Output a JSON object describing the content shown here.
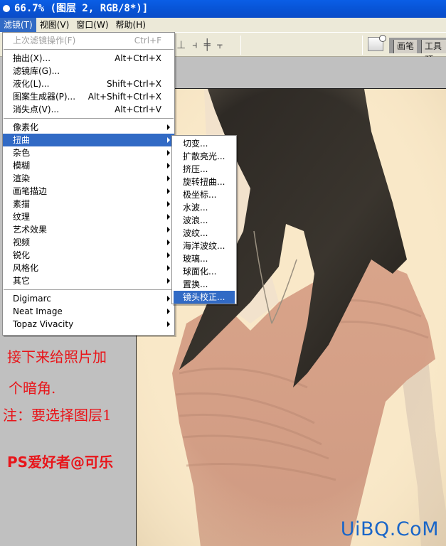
{
  "window": {
    "title": "66.7% (图层 2, RGB/8*)]"
  },
  "menubar": {
    "items": [
      {
        "label": "滤镜(T)",
        "active": true
      },
      {
        "label": "视图(V)",
        "active": false
      },
      {
        "label": "窗口(W)",
        "active": false
      },
      {
        "label": "帮助(H)",
        "active": false
      }
    ]
  },
  "optionsbar": {
    "align_icons": [
      "align-bottom-edges-icon",
      "distribute-left-icon",
      "distribute-horizontal-centers-icon",
      "distribute-right-icon"
    ],
    "palette_tabs": [
      "画笔",
      "工具预"
    ]
  },
  "filter_menu": {
    "last_filter": {
      "label": "上次滤镜操作(F)",
      "shortcut": "Ctrl+F",
      "disabled": true
    },
    "group1": [
      {
        "label": "抽出(X)...",
        "shortcut": "Alt+Ctrl+X"
      },
      {
        "label": "滤镜库(G)...",
        "shortcut": ""
      },
      {
        "label": "液化(L)...",
        "shortcut": "Shift+Ctrl+X"
      },
      {
        "label": "图案生成器(P)...",
        "shortcut": "Alt+Shift+Ctrl+X"
      },
      {
        "label": "消失点(V)...",
        "shortcut": "Alt+Ctrl+V"
      }
    ],
    "group2": [
      {
        "label": "像素化",
        "highlight": false
      },
      {
        "label": "扭曲",
        "highlight": true
      },
      {
        "label": "杂色",
        "highlight": false
      },
      {
        "label": "模糊",
        "highlight": false
      },
      {
        "label": "渲染",
        "highlight": false
      },
      {
        "label": "画笔描边",
        "highlight": false
      },
      {
        "label": "素描",
        "highlight": false
      },
      {
        "label": "纹理",
        "highlight": false
      },
      {
        "label": "艺术效果",
        "highlight": false
      },
      {
        "label": "视频",
        "highlight": false
      },
      {
        "label": "锐化",
        "highlight": false
      },
      {
        "label": "风格化",
        "highlight": false
      },
      {
        "label": "其它",
        "highlight": false
      }
    ],
    "group3": [
      {
        "label": "Digimarc"
      },
      {
        "label": "Neat Image"
      },
      {
        "label": "Topaz Vivacity"
      }
    ]
  },
  "distort_submenu": {
    "items": [
      {
        "label": "切变...",
        "highlight": false
      },
      {
        "label": "扩散亮光...",
        "highlight": false
      },
      {
        "label": "挤压...",
        "highlight": false
      },
      {
        "label": "旋转扭曲...",
        "highlight": false
      },
      {
        "label": "极坐标...",
        "highlight": false
      },
      {
        "label": "水波...",
        "highlight": false
      },
      {
        "label": "波浪...",
        "highlight": false
      },
      {
        "label": "波纹...",
        "highlight": false
      },
      {
        "label": "海洋波纹...",
        "highlight": false
      },
      {
        "label": "玻璃...",
        "highlight": false
      },
      {
        "label": "球面化...",
        "highlight": false
      },
      {
        "label": "置换...",
        "highlight": false
      },
      {
        "label": "镜头校正...",
        "highlight": true
      }
    ]
  },
  "annotations": {
    "line1": "接下来给照片加",
    "line2": "个暗角.",
    "line3": "注：要选择图层1",
    "signature": "PS爱好者@可乐"
  },
  "watermark": "UiBQ.CoM",
  "colors": {
    "title_bar": "#0854d6",
    "menu_highlight": "#316ac5",
    "annotation_red": "#e8151a",
    "watermark_blue": "#1a66c8",
    "canvas_bg": "#f8e6c4"
  }
}
